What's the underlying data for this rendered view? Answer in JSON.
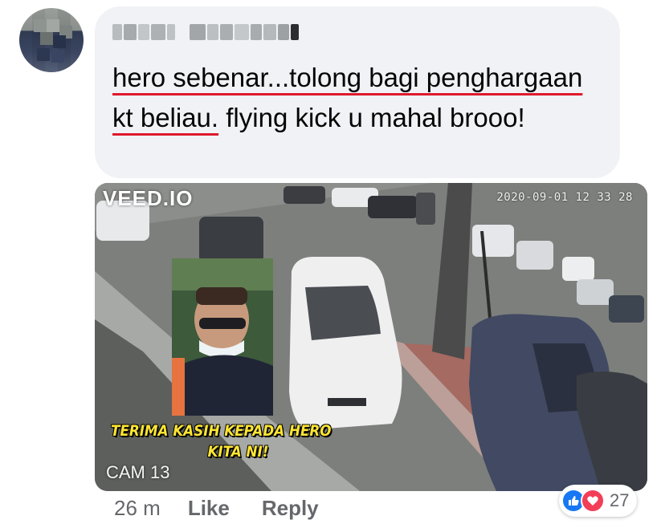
{
  "comment": {
    "text_underlined": "hero sebenar...tolong bagi penghargaan kt beliau.",
    "text_rest": " flying kick u mahal brooo!"
  },
  "video": {
    "watermark": "VEED.IO",
    "timestamp": "2020-09-01 12 33 28",
    "camera_label": "CAM 13",
    "caption_line1": "TERIMA KASIH KEPADA HERO",
    "caption_line2": "KITA NI!"
  },
  "actions": {
    "time": "26 m",
    "like_label": "Like",
    "reply_label": "Reply"
  },
  "reactions": {
    "icons": [
      "like-icon",
      "love-icon"
    ],
    "count": "27",
    "colors": {
      "like": "#1877f2",
      "love": "#f33e58"
    }
  },
  "colors": {
    "bubble": "#f0f2f5",
    "underline": "#e0192d",
    "secondary_text": "#65676b",
    "caption": "#ffe633"
  }
}
